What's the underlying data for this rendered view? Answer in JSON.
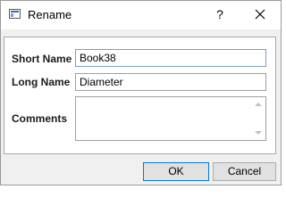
{
  "window": {
    "title": "Rename",
    "help_label": "?"
  },
  "form": {
    "short_name_label": "Short Name",
    "short_name_value": "Book38",
    "long_name_label": "Long Name",
    "long_name_value": "Diameter",
    "comments_label": "Comments",
    "comments_value": ""
  },
  "buttons": {
    "ok_label": "OK",
    "cancel_label": "Cancel"
  },
  "colors": {
    "focus_border": "#7a9cc6",
    "default_button_border": "#0078d7",
    "panel_background": "#ffffff",
    "dialog_background": "#f0f0f0"
  },
  "icons": {
    "app": "window-app-icon",
    "help": "help-icon",
    "close": "close-icon",
    "scroll_up": "scroll-up-arrow-icon",
    "scroll_down": "scroll-down-arrow-icon"
  }
}
